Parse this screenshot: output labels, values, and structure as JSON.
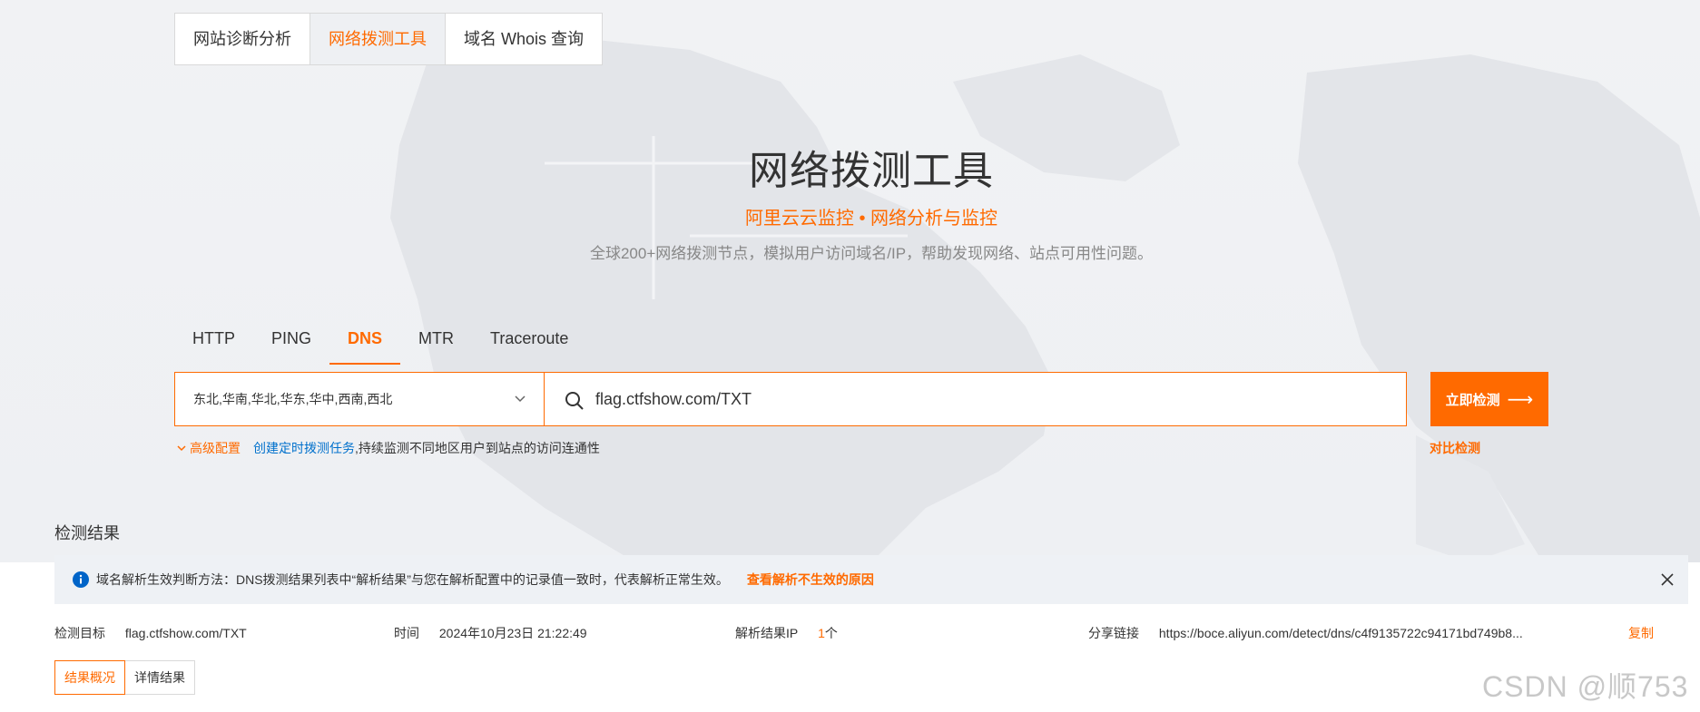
{
  "tool_tabs": [
    {
      "label": "网站诊断分析",
      "active": false
    },
    {
      "label": "网络拨测工具",
      "active": true
    },
    {
      "label": "域名 Whois 查询",
      "active": false
    }
  ],
  "hero": {
    "title": "网络拨测工具",
    "subtitle": "阿里云云监控 • 网络分析与监控",
    "description": "全球200+网络拨测节点，模拟用户访问域名/IP，帮助发现网络、站点可用性问题。"
  },
  "protocol_tabs": [
    {
      "label": "HTTP",
      "active": false
    },
    {
      "label": "PING",
      "active": false
    },
    {
      "label": "DNS",
      "active": true
    },
    {
      "label": "MTR",
      "active": false
    },
    {
      "label": "Traceroute",
      "active": false
    }
  ],
  "form": {
    "regions_value": "东北,华南,华北,华东,华中,西南,西北",
    "target_value": "flag.ctfshow.com/TXT",
    "detect_button": "立即检测",
    "advanced_label": "高级配置",
    "schedule_link": "创建定时拨测任务",
    "schedule_suffix": ",持续监测不同地区用户到站点的访问连通性",
    "compare_link": "对比检测"
  },
  "results": {
    "title": "检测结果",
    "notice_text": "域名解析生效判断方法：DNS拨测结果列表中“解析结果”与您在解析配置中的记录值一致时，代表解析正常生效。",
    "notice_link": "查看解析不生效的原因",
    "target_label": "检测目标",
    "target_value": "flag.ctfshow.com/TXT",
    "time_label": "时间",
    "time_value": "2024年10月23日 21:22:49",
    "ip_label": "解析结果IP",
    "ip_count": "1",
    "ip_unit": "个",
    "share_label": "分享链接",
    "share_value": "https://boce.aliyun.com/detect/dns/c4f9135722c94171bd749b8...",
    "copy_label": "复制",
    "sub_tabs": [
      {
        "label": "结果概况",
        "active": true
      },
      {
        "label": "详情结果",
        "active": false
      }
    ]
  },
  "watermark": "CSDN @顺753",
  "colors": {
    "accent": "#ff6a00",
    "link": "#0070cc",
    "notice_bg": "#eef1f5"
  }
}
